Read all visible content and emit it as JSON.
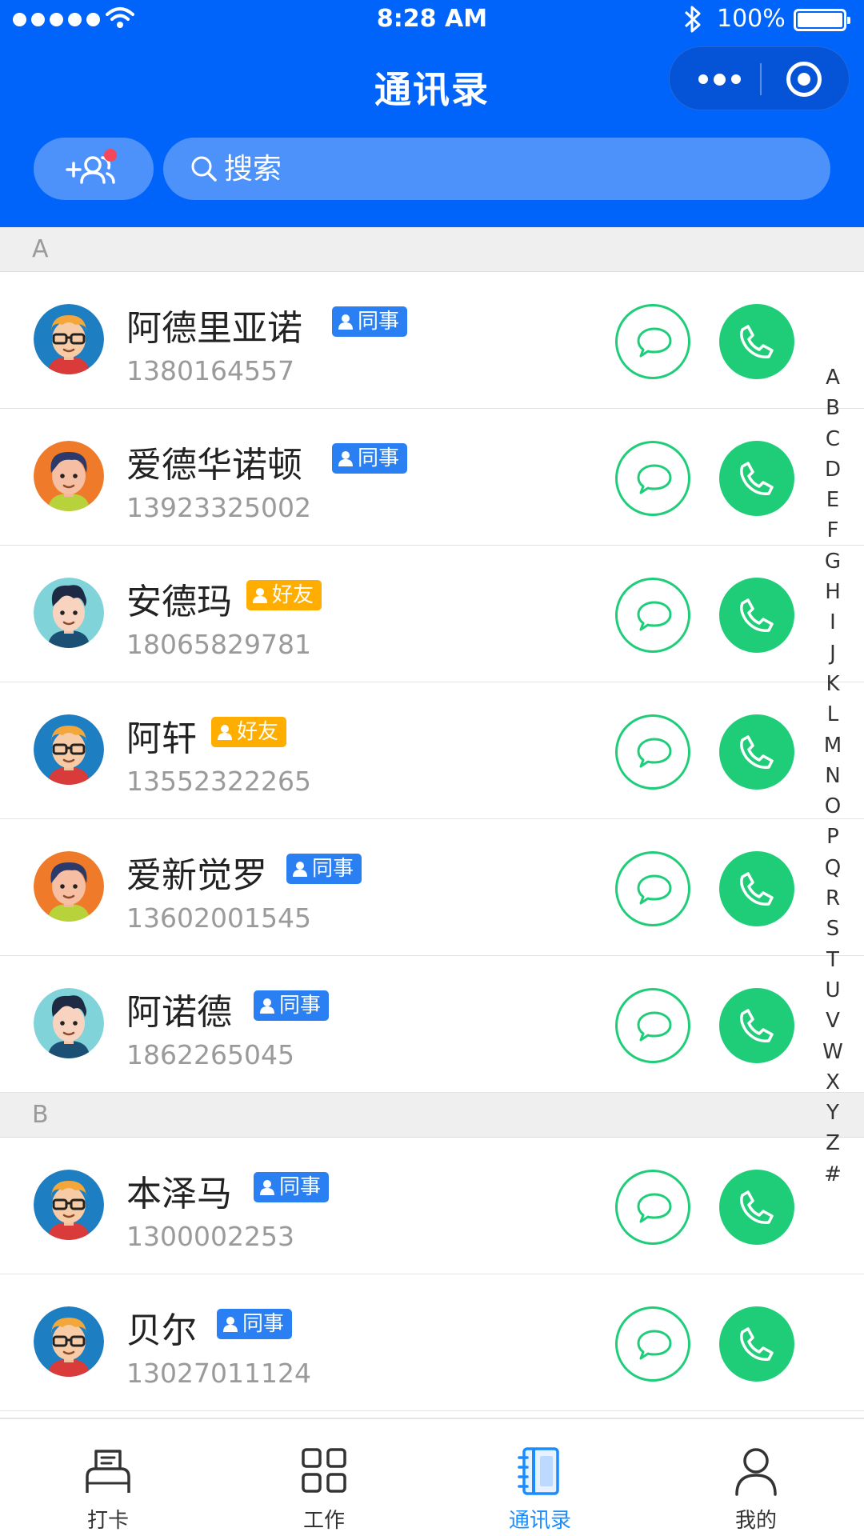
{
  "status_bar": {
    "time": "8:28 AM",
    "battery": "100%"
  },
  "header": {
    "title": "通讯录",
    "search_placeholder": "搜索"
  },
  "sections": [
    {
      "letter": "A",
      "contacts": [
        {
          "name": "阿德里亚诺",
          "phone": "1380164557",
          "tag": "同事",
          "tag_type": "colleague",
          "avatar": "glasses-man"
        },
        {
          "name": "爱德华诺顿",
          "phone": "13923325002",
          "tag": "同事",
          "tag_type": "colleague",
          "avatar": "orange-man"
        },
        {
          "name": "安德玛",
          "phone": "18065829781",
          "tag": "好友",
          "tag_type": "friend",
          "avatar": "teal-man"
        },
        {
          "name": "阿轩",
          "phone": "13552322265",
          "tag": "好友",
          "tag_type": "friend",
          "avatar": "glasses-man"
        },
        {
          "name": "爱新觉罗",
          "phone": "13602001545",
          "tag": "同事",
          "tag_type": "colleague",
          "avatar": "orange-man"
        },
        {
          "name": "阿诺德",
          "phone": "1862265045",
          "tag": "同事",
          "tag_type": "colleague",
          "avatar": "teal-man"
        }
      ]
    },
    {
      "letter": "B",
      "contacts": [
        {
          "name": "本泽马",
          "phone": "1300002253",
          "tag": "同事",
          "tag_type": "colleague",
          "avatar": "glasses-man"
        },
        {
          "name": "贝尔",
          "phone": "13027011124",
          "tag": "同事",
          "tag_type": "colleague",
          "avatar": "glasses-man"
        }
      ]
    }
  ],
  "alphabet_index": [
    "A",
    "B",
    "C",
    "D",
    "E",
    "F",
    "G",
    "H",
    "I",
    "J",
    "K",
    "L",
    "M",
    "N",
    "O",
    "P",
    "Q",
    "R",
    "S",
    "T",
    "U",
    "V",
    "W",
    "X",
    "Y",
    "Z",
    "#"
  ],
  "tabbar": [
    {
      "label": "打卡",
      "icon": "punch-card-icon",
      "active": false
    },
    {
      "label": "工作",
      "icon": "grid-icon",
      "active": false
    },
    {
      "label": "通讯录",
      "icon": "contacts-book-icon",
      "active": true
    },
    {
      "label": "我的",
      "icon": "person-icon",
      "active": false
    }
  ],
  "colors": {
    "header_blue": "#0064fa",
    "action_green": "#1fcd79",
    "colleague_tag": "#2a7ff3",
    "friend_tag": "#ffae00",
    "active_tab": "#1a8cff"
  }
}
